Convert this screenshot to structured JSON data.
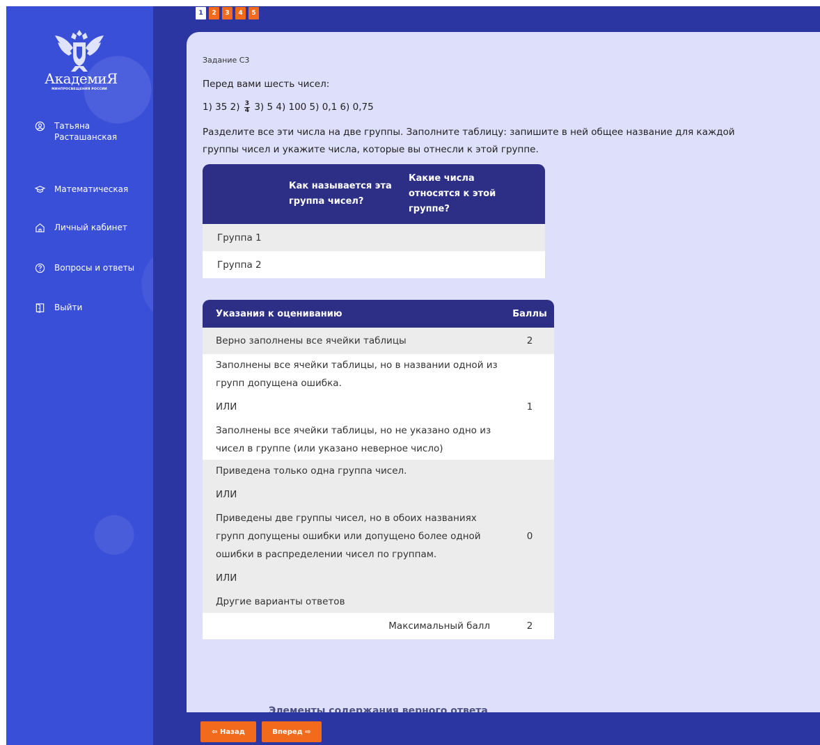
{
  "pager": {
    "pages": [
      "1",
      "2",
      "3",
      "4",
      "5"
    ],
    "active_index": 0
  },
  "logo": {
    "wordmark": "АкадемиЯ",
    "subtitle": "МИНПРОСВЕЩЕНИЯ РОССИИ"
  },
  "sidebar": {
    "user_name": "Татьяна Расташанская",
    "items": [
      {
        "label": "Математическая",
        "icon": "graduation-cap-icon"
      },
      {
        "label": "Личный кабинет",
        "icon": "home-icon"
      },
      {
        "label": "Вопросы и ответы",
        "icon": "question-circle-icon"
      },
      {
        "label": "Выйти",
        "icon": "exit-door-icon"
      }
    ]
  },
  "task": {
    "label": "Задание С3",
    "intro": "Перед вами шесть чисел:",
    "numbers_before": "1) 35 2) ",
    "fraction_num": "3",
    "fraction_den": "4",
    "numbers_after": " 3) 5 4) 100 5) 0,1 6) 0,75",
    "instruction_line1": "Разделите все эти числа на две группы. Заполните таблицу: запишите в ней общее название для каждой",
    "instruction_line2": "группы чисел и укажите числа, которые вы отнесли к этой группе."
  },
  "answer_table": {
    "headers": [
      "",
      "Как называется эта группа чисел?",
      "Какие числа относятся к этой группе?"
    ],
    "rows": [
      "Группа 1",
      "Группа 2"
    ]
  },
  "grading_table": {
    "header_criteria": "Указания к оцениванию",
    "header_points": "Баллы",
    "rows": [
      {
        "lines": [
          "Верно заполнены все ячейки таблицы"
        ],
        "score": "2"
      },
      {
        "lines": [
          "Заполнены все ячейки таблицы, но в названии одной из групп допущена ошибка.",
          "ИЛИ",
          "Заполнены все ячейки таблицы, но не указано одно из чисел в группе (или указано неверное число)"
        ],
        "score": "1"
      },
      {
        "lines": [
          "Приведена только одна группа чисел.",
          "ИЛИ",
          "Приведены две группы чисел, но в обоих названиях групп допущены ошибки или допущено более одной ошибки в распределении чисел по группам.",
          "ИЛИ",
          "Другие варианты ответов"
        ],
        "score": "0"
      }
    ],
    "max_label": "Максимальный балл",
    "max_score": "2"
  },
  "next_section_heading": "Элементы содержания верного ответа",
  "nav_buttons": {
    "back": "⇦ Назад",
    "forward": "Вперед ⇨"
  }
}
